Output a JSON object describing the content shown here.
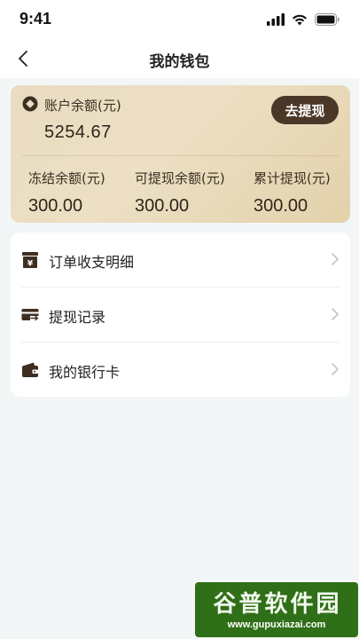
{
  "status_bar": {
    "time": "9:41",
    "icons": [
      "signal-icon",
      "wifi-icon",
      "battery-icon"
    ]
  },
  "nav": {
    "title": "我的钱包",
    "back_icon": "chevron-left-icon"
  },
  "balance_card": {
    "icon": "coin-icon",
    "label": "账户余额(元)",
    "value": "5254.67",
    "withdraw_button": "去提现",
    "stats": [
      {
        "label": "冻结余额(元)",
        "value": "300.00"
      },
      {
        "label": "可提现余额(元)",
        "value": "300.00"
      },
      {
        "label": "累计提现(元)",
        "value": "300.00"
      }
    ]
  },
  "menu": {
    "items": [
      {
        "label": "订单收支明细",
        "icon": "ledger-icon"
      },
      {
        "label": "提现记录",
        "icon": "card-transfer-icon"
      },
      {
        "label": "我的银行卡",
        "icon": "wallet-icon"
      }
    ]
  },
  "watermark": {
    "title": "谷普软件园",
    "url": "www.gupuxiazai.com"
  },
  "colors": {
    "card_gradient_start": "#e9dcc0",
    "card_gradient_end": "#e3d1ab",
    "accent_dark_brown": "#4a3727",
    "page_background": "#f3f6f7",
    "watermark_green": "#2f6f17"
  }
}
